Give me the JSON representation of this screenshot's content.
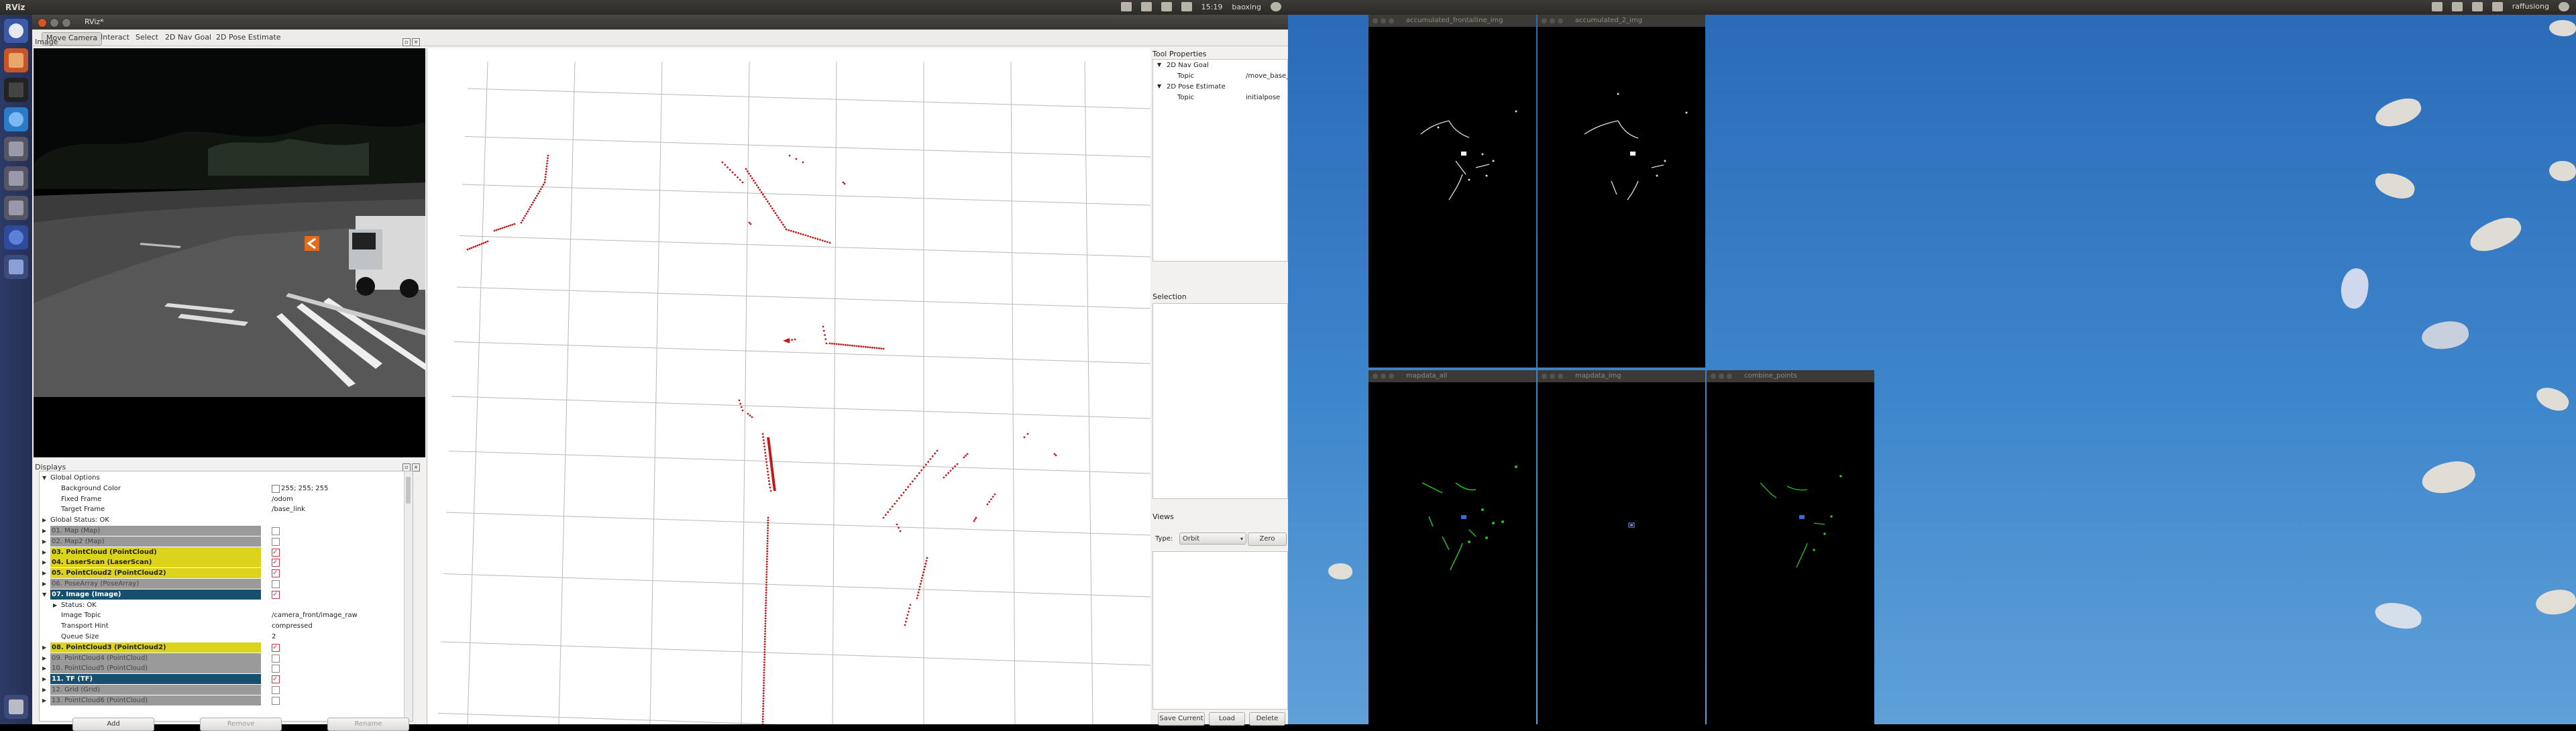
{
  "topbar": {
    "app_title": "RViz",
    "time": "15:19",
    "user": "baoxing"
  },
  "topbar2": {
    "user": "raffusiong"
  },
  "rviz": {
    "window_title": "RViz*",
    "toolbar": [
      "Move Camera",
      "Interact",
      "Select",
      "2D Nav Goal",
      "2D Pose Estimate"
    ],
    "image_panel_title": "Image",
    "displays_panel_title": "Displays",
    "displays_rows": [
      {
        "label": "Global Options",
        "indent": 1,
        "style": "plain",
        "arrow": "down"
      },
      {
        "label": "Background Color",
        "indent": 2,
        "style": "plain",
        "value": "255; 255; 255"
      },
      {
        "label": "Fixed Frame",
        "indent": 2,
        "style": "plain",
        "value": "/odom"
      },
      {
        "label": "Target Frame",
        "indent": 2,
        "style": "plain",
        "value": "/base_link"
      },
      {
        "label": "Global Status: OK",
        "indent": 1,
        "style": "plain",
        "arrow": "right"
      },
      {
        "label": "01. Map (Map)",
        "indent": 1,
        "style": "gray",
        "arrow": "right",
        "check": false
      },
      {
        "label": "02. Map2 (Map)",
        "indent": 1,
        "style": "gray",
        "arrow": "right",
        "check": false
      },
      {
        "label": "03. PointCloud (PointCloud)",
        "indent": 1,
        "style": "yellow",
        "arrow": "right",
        "check": true
      },
      {
        "label": "04. LaserScan (LaserScan)",
        "indent": 1,
        "style": "yellow",
        "arrow": "right",
        "check": true
      },
      {
        "label": "05. PointCloud2 (PointCloud2)",
        "indent": 1,
        "style": "yellow",
        "arrow": "right",
        "check": true
      },
      {
        "label": "06. PoseArray (PoseArray)",
        "indent": 1,
        "style": "gray",
        "arrow": "right",
        "check": false
      },
      {
        "label": "07. Image (Image)",
        "indent": 1,
        "style": "teal",
        "arrow": "down",
        "check": true
      },
      {
        "label": "Status: OK",
        "indent": 2,
        "style": "plain",
        "arrow": "right"
      },
      {
        "label": "Image Topic",
        "indent": 2,
        "style": "plain",
        "value": "/camera_front/image_raw"
      },
      {
        "label": "Transport Hint",
        "indent": 2,
        "style": "plain",
        "value": "compressed"
      },
      {
        "label": "Queue Size",
        "indent": 2,
        "style": "plain",
        "value": "2"
      },
      {
        "label": "08. PointCloud3 (PointCloud2)",
        "indent": 1,
        "style": "yellow",
        "arrow": "right",
        "check": true
      },
      {
        "label": "09. PointCloud4 (PointCloud)",
        "indent": 1,
        "style": "gray",
        "arrow": "right",
        "check": false
      },
      {
        "label": "10. PointCloud5 (PointCloud)",
        "indent": 1,
        "style": "gray",
        "arrow": "right",
        "check": false
      },
      {
        "label": "11. TF (TF)",
        "indent": 1,
        "style": "teal",
        "arrow": "right",
        "check": true
      },
      {
        "label": "12. Grid (Grid)",
        "indent": 1,
        "style": "gray",
        "arrow": "right",
        "check": false
      },
      {
        "label": "13. PointCloud6 (PointCloud)",
        "indent": 1,
        "style": "gray",
        "arrow": "right",
        "check": false
      }
    ],
    "display_buttons": [
      "Add",
      "Remove",
      "Rename"
    ],
    "tool_properties_title": "Tool Properties",
    "tool_properties": [
      {
        "label": "2D Nav Goal",
        "sub_label": "Topic",
        "sub_value": "/move_base_simple/"
      },
      {
        "label": "2D Pose Estimate",
        "sub_label": "Topic",
        "sub_value": "initialpose"
      }
    ],
    "selection_title": "Selection",
    "views_title": "Views",
    "views_type_label": "Type:",
    "views_type_value": "Orbit",
    "views_zero": "Zero",
    "views_buttons": [
      "Save Current",
      "Load",
      "Delete"
    ]
  },
  "image_windows": [
    {
      "title": "accumulated_frontalline_img"
    },
    {
      "title": "accumulated_2_img"
    },
    {
      "title": "mapdata_all"
    },
    {
      "title": "mapdata_img"
    },
    {
      "title": "combine_points"
    }
  ],
  "colors": {
    "rviz_bg": "#f2f1f0",
    "yellow_row": "#dcd41c",
    "teal_row": "#17506e",
    "scan_red": "#c21a1a",
    "green_points": "#22c322",
    "desktop_sky": "#3e86cc"
  }
}
